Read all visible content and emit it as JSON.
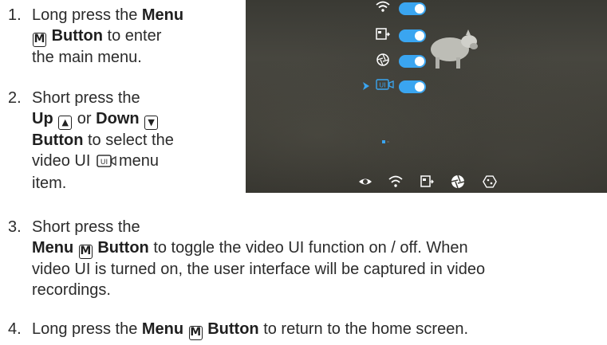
{
  "steps": [
    {
      "number": "1.",
      "lines": [
        [
          "Long press the ",
          "Menu"
        ],
        [
          "Button",
          " to enter"
        ],
        [
          "the main menu."
        ]
      ]
    },
    {
      "number": "2.",
      "lines": [
        [
          "Short press the"
        ],
        [
          "Up",
          "or",
          "Down"
        ],
        [
          "Button",
          " to select the"
        ],
        [
          "video UI",
          "menu"
        ],
        [
          "item."
        ]
      ]
    },
    {
      "number": "3.",
      "lines": [
        [
          "Short press the"
        ],
        [
          "Menu",
          "Button",
          " to toggle the video UI function on / off. When"
        ],
        [
          "video UI is turned on, the user interface will be captured in video"
        ],
        [
          "recordings."
        ]
      ]
    },
    {
      "number": "4.",
      "lines": [
        [
          "Long press the ",
          "Menu",
          "Button",
          " to return to the home screen."
        ]
      ]
    }
  ],
  "keys": {
    "menu": "M",
    "up": "▲",
    "down": "▼",
    "ui": "UI"
  },
  "device": {
    "menu_items": [
      "wifi",
      "video-output",
      "aperture",
      "video-ui"
    ],
    "toggle_color": "#3aa5f0",
    "bottom_icons": [
      "eye-icon",
      "wifi-icon",
      "video-output-icon",
      "aperture-icon",
      "settings-icon"
    ]
  }
}
